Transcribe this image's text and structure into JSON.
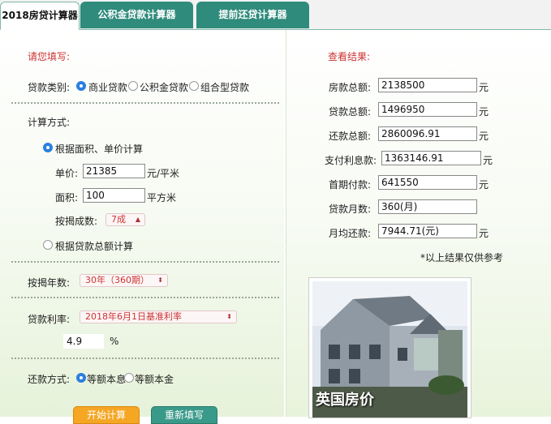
{
  "tabs": [
    "2018房贷计算器",
    "公积金贷款计算器",
    "提前还贷计算器"
  ],
  "form": {
    "title": "请您填写:",
    "loan_type_label": "贷款类别:",
    "loan_types": [
      "商业贷款",
      "公积金贷款",
      "组合型贷款"
    ],
    "calc_method_label": "计算方式:",
    "method_area": "根据面积、单价计算",
    "unit_price_label": "单价:",
    "unit_price_value": "21385",
    "unit_price_unit": "元/平米",
    "area_label": "面积:",
    "area_value": "100",
    "area_unit": "平方米",
    "ratio_label": "按揭成数:",
    "ratio_value": "7成",
    "method_total": "根据贷款总额计算",
    "years_label": "按揭年数:",
    "years_value": "30年（360期）",
    "rate_label": "贷款利率:",
    "rate_value": "2018年6月1日基准利率",
    "rate_number": "4.9",
    "rate_unit": "%",
    "repay_label": "还款方式:",
    "repay_options": [
      "等额本息",
      "等额本金"
    ],
    "calc_button": "开始计算",
    "reset_button": "重新填写"
  },
  "results": {
    "title": "查看结果:",
    "rows": [
      {
        "label": "房款总额:",
        "value": "2138500",
        "unit": "元"
      },
      {
        "label": "贷款总额:",
        "value": "1496950",
        "unit": "元"
      },
      {
        "label": "还款总额:",
        "value": "2860096.91",
        "unit": "元"
      },
      {
        "label": "支付利息款:",
        "value": "1363146.91",
        "unit": "元"
      },
      {
        "label": "首期付款:",
        "value": "641550",
        "unit": "元"
      },
      {
        "label": "贷款月数:",
        "value": "360(月)",
        "unit": ""
      },
      {
        "label": "月均还款:",
        "value": "7944.71(元)",
        "unit": "元"
      }
    ],
    "note": "*以上结果仅供参考"
  },
  "ad": {
    "caption": "英国房价"
  },
  "colors": {
    "tab_teal": "#2f8b7c",
    "label_red": "#cc3333",
    "radio_blue": "#2a7fe0",
    "button_orange": "#f5a623"
  }
}
